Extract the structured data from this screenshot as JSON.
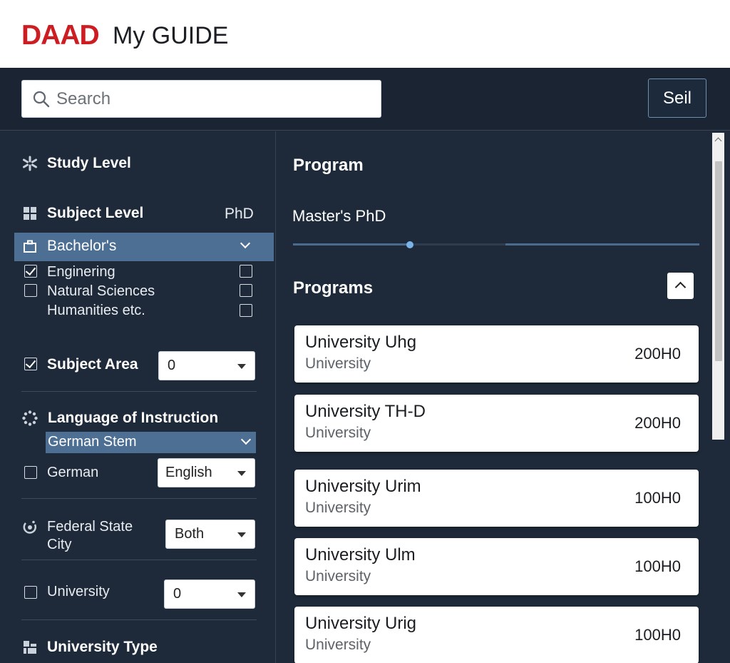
{
  "header": {
    "logo": "DAAD",
    "title": "My GUIDE"
  },
  "search": {
    "placeholder": "Search",
    "button_label": "Seil"
  },
  "sidebar": {
    "study_level": {
      "label": "Study Level"
    },
    "subject_level": {
      "label": "Subject Level",
      "right_label": "PhD"
    },
    "bachelors": {
      "label": "Bachelor's"
    },
    "subjects": [
      {
        "label": "Enginering",
        "checked": true
      },
      {
        "label": "Natural Sciences",
        "checked": false
      },
      {
        "label": "Humanities etc.",
        "checked": false
      }
    ],
    "subject_area": {
      "label": "Subject Area",
      "checked": true,
      "value": "0"
    },
    "language": {
      "label": "Language of Instruction",
      "selected": "German Stem",
      "option_label": "German",
      "value": "English"
    },
    "federal_state": {
      "label_line1": "Federal State",
      "label_line2": "City",
      "value": "Both"
    },
    "university": {
      "label": "University",
      "value": "0"
    },
    "university_type": {
      "label": "University Type"
    }
  },
  "main": {
    "program_title": "Program",
    "degree_label": "Master's PhD",
    "programs_title": "Programs",
    "cards": [
      {
        "name": "University Uhg",
        "type": "University",
        "value": "200H0"
      },
      {
        "name": "University TH-D",
        "type": "University",
        "value": "200H0"
      },
      {
        "name": "University Urim",
        "type": "University",
        "value": "100H0"
      },
      {
        "name": "University Ulm",
        "type": "University",
        "value": "100H0"
      },
      {
        "name": "University Urig",
        "type": "University",
        "value": "100H0"
      }
    ]
  },
  "colors": {
    "brand": "#cc1d23",
    "panel": "#1e2a3a",
    "highlight": "#4e6f94"
  }
}
